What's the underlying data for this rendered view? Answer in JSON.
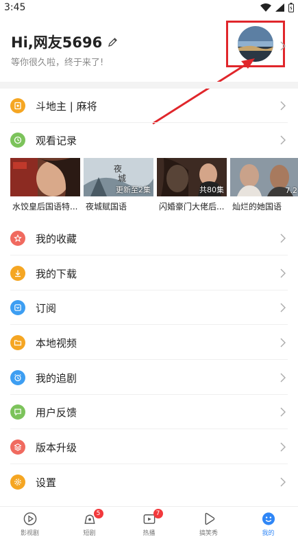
{
  "status_bar": {
    "time": "3:45"
  },
  "profile": {
    "greeting": "Hi,网友5696",
    "subtitle": "等你很久啦，终于来了!"
  },
  "menu": {
    "doudizhu": "斗地主 | 麻将",
    "history": "观看记录",
    "favorites": "我的收藏",
    "downloads": "我的下载",
    "subscribe": "订阅",
    "local_video": "本地视频",
    "following": "我的追剧",
    "feedback": "用户反馈",
    "upgrade": "版本升级",
    "settings": "设置"
  },
  "history_items": [
    {
      "title": "水饺皇后国语特...",
      "badge": ""
    },
    {
      "title": "夜城赋国语",
      "badge": "更新至2集"
    },
    {
      "title": "闪婚豪门大佬后...",
      "badge": "共80集"
    },
    {
      "title": "灿烂的她国语",
      "badge": "7.2"
    }
  ],
  "tabs": [
    {
      "label": "影视剧",
      "badge": ""
    },
    {
      "label": "短剧",
      "badge": "5"
    },
    {
      "label": "热播",
      "badge": "7"
    },
    {
      "label": "搞笑秀",
      "badge": ""
    },
    {
      "label": "我的",
      "badge": ""
    }
  ],
  "colors": {
    "accent": "#2f86f6",
    "highlight_box": "#e0262b",
    "badge": "#f2393c"
  }
}
